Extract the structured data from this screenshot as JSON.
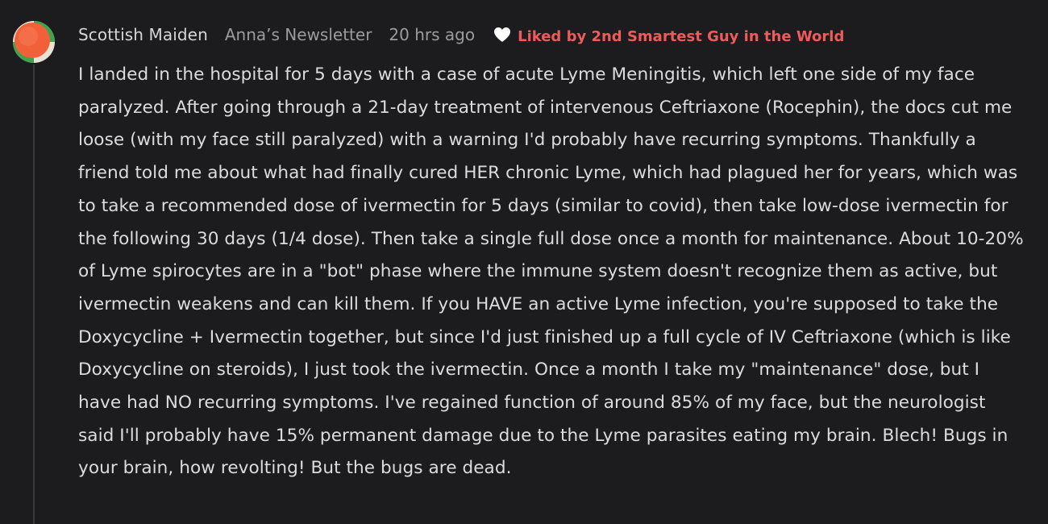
{
  "comment": {
    "author": "Scottish Maiden",
    "publication": "Anna’s Newsletter",
    "timestamp": "20 hrs ago",
    "liked_by": "Liked by 2nd Smartest Guy in the World",
    "heart_icon": "heart-icon",
    "avatar_icon": "avatar-circle",
    "colors": {
      "background": "#1c1c1e",
      "author": "#d6d6d6",
      "meta": "#9c9c9c",
      "liked": "#ef5b5b",
      "body": "#dcdcdc",
      "avatar_primary": "#f2603a",
      "avatar_secondary": "#3fa34d"
    },
    "body": "I landed in the hospital for 5 days with a case of acute Lyme Meningitis, which left one side of my face paralyzed. After going through a 21-day treatment of intervenous Ceftriaxone (Rocephin), the docs cut me loose (with my face still paralyzed) with a warning I'd probably have recurring symptoms. Thankfully a friend told me about what had finally cured HER chronic Lyme, which had plagued her for years, which was to take a recommended dose of ivermectin for 5 days (similar to covid), then take low-dose ivermectin for the following 30 days (1/4 dose). Then take a single full dose once a month for maintenance. About 10-20% of Lyme spirocytes are in a \"bot\" phase where the immune system doesn't recognize them as active, but ivermectin weakens and can kill them. If you HAVE an active Lyme infection, you're supposed to take the Doxycycline + Ivermectin together, but since I'd just finished up a full cycle of IV Ceftriaxone (which is like Doxycycline on steroids), I just took the ivermectin. Once a month I take my \"maintenance\" dose, but I have had NO recurring symptoms. I've regained function of around 85% of my face, but the neurologist said I'll probably have 15% permanent damage due to the Lyme parasites eating my brain. Blech! Bugs in your brain, how revolting! But the bugs are dead."
  }
}
